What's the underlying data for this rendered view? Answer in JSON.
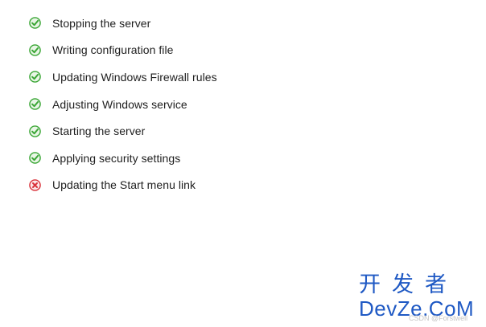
{
  "steps": [
    {
      "label": "Stopping the server",
      "status": "success",
      "icon": "check-circle-icon"
    },
    {
      "label": "Writing configuration file",
      "status": "success",
      "icon": "check-circle-icon"
    },
    {
      "label": "Updating Windows Firewall rules",
      "status": "success",
      "icon": "check-circle-icon"
    },
    {
      "label": "Adjusting Windows service",
      "status": "success",
      "icon": "check-circle-icon"
    },
    {
      "label": "Starting the server",
      "status": "success",
      "icon": "check-circle-icon"
    },
    {
      "label": "Applying security settings",
      "status": "success",
      "icon": "check-circle-icon"
    },
    {
      "label": "Updating the Start menu link",
      "status": "error",
      "icon": "error-x-icon"
    }
  ],
  "colors": {
    "success": "#3aa635",
    "error": "#d9333b",
    "text": "#1e1e1e",
    "watermark": "#1f59c4"
  },
  "watermark": {
    "cn_text": "开发者",
    "en_text": "DevZe.CoM",
    "credit": "CSDN @Forstwell"
  }
}
